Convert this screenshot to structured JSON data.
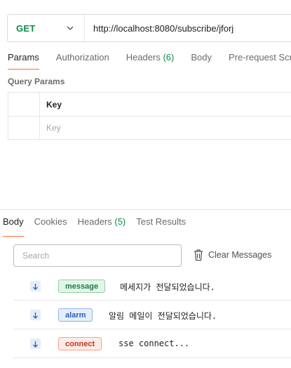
{
  "request": {
    "method": "GET",
    "url": "http://localhost:8080/subscribe/jforj"
  },
  "request_tabs": [
    {
      "label": "Params",
      "count": ""
    },
    {
      "label": "Authorization",
      "count": ""
    },
    {
      "label": "Headers",
      "count": "(6)"
    },
    {
      "label": "Body",
      "count": ""
    },
    {
      "label": "Pre-request Scr",
      "count": ""
    }
  ],
  "query_params": {
    "title": "Query Params",
    "header_key": "Key",
    "key_placeholder": "Key"
  },
  "response_tabs": [
    {
      "label": "Body",
      "count": ""
    },
    {
      "label": "Cookies",
      "count": ""
    },
    {
      "label": "Headers",
      "count": "(5)"
    },
    {
      "label": "Test Results",
      "count": ""
    }
  ],
  "response": {
    "search_placeholder": "Search",
    "clear_label": "Clear Messages",
    "messages": [
      {
        "event": "message",
        "text": "메세지가 전달되었습니다.",
        "icon": "arrow-down-icon"
      },
      {
        "event": "alarm",
        "text": "알림 메일이 전달되었습니다.",
        "icon": "arrow-down-icon"
      },
      {
        "event": "connect",
        "text": "sse connect...",
        "icon": "arrow-down-icon"
      }
    ]
  },
  "colors": {
    "accent": "#ff6c37",
    "get": "#0f8a4a",
    "message_bg": "#e3f5e9",
    "message_fg": "#1f7a45",
    "message_border": "#8fd1a8",
    "alarm_bg": "#e5eefb",
    "alarm_fg": "#2b5fb4",
    "alarm_border": "#93b4e6",
    "connect_bg": "#fdebe6",
    "connect_fg": "#c0391b",
    "connect_border": "#f0a48f"
  }
}
